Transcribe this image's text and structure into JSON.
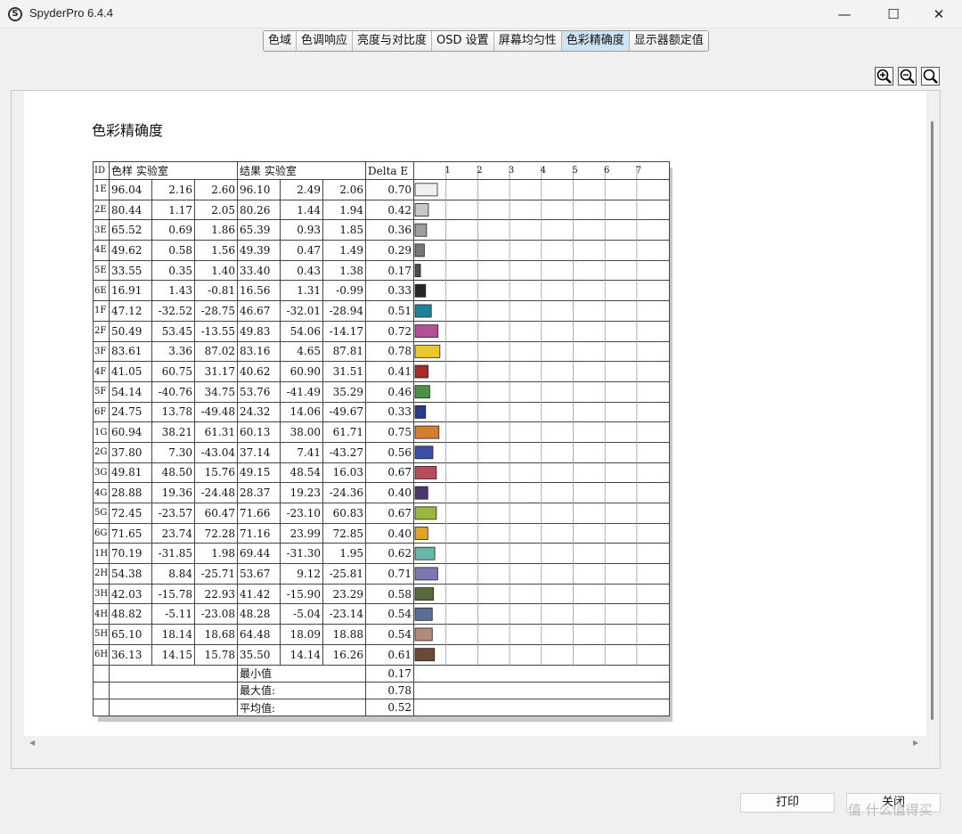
{
  "window": {
    "title": "SpyderPro 6.4.4",
    "app_icon": "S"
  },
  "tabs": [
    {
      "label": "色域",
      "active": false
    },
    {
      "label": "色调响应",
      "active": false
    },
    {
      "label": "亮度与对比度",
      "active": false
    },
    {
      "label": "OSD 设置",
      "active": false
    },
    {
      "label": "屏幕均匀性",
      "active": false
    },
    {
      "label": "色彩精确度",
      "active": true
    },
    {
      "label": "显示器额定值",
      "active": false
    }
  ],
  "zoom_icons": [
    "zoom-in-icon",
    "zoom-out-icon",
    "zoom-reset-icon"
  ],
  "report": {
    "title": "色彩精确度",
    "headers": {
      "id": "ID",
      "sample": "色样 实验室",
      "result": "结果 实验室",
      "delta": "Delta E"
    },
    "summary": [
      {
        "label": "最小值",
        "value": "0.17"
      },
      {
        "label": "最大值:",
        "value": "0.78"
      },
      {
        "label": "平均值:",
        "value": "0.52"
      }
    ]
  },
  "chart_data": {
    "type": "bar",
    "orientation": "horizontal",
    "x_ticks": [
      "1",
      "2",
      "3",
      "4",
      "5",
      "6",
      "7"
    ],
    "xlim": [
      0,
      7.8
    ],
    "grid": true,
    "rows": [
      {
        "id": "1E",
        "s": [
          "96.04",
          "2.16",
          "2.60"
        ],
        "r": [
          "96.10",
          "2.49",
          "2.06"
        ],
        "de": 0.7,
        "color": "#f2f0ed"
      },
      {
        "id": "2E",
        "s": [
          "80.44",
          "1.17",
          "2.05"
        ],
        "r": [
          "80.26",
          "1.44",
          "1.94"
        ],
        "de": 0.42,
        "color": "#c8c8c8"
      },
      {
        "id": "3E",
        "s": [
          "65.52",
          "0.69",
          "1.86"
        ],
        "r": [
          "65.39",
          "0.93",
          "1.85"
        ],
        "de": 0.36,
        "color": "#9e9e9e"
      },
      {
        "id": "4E",
        "s": [
          "49.62",
          "0.58",
          "1.56"
        ],
        "r": [
          "49.39",
          "0.47",
          "1.49"
        ],
        "de": 0.29,
        "color": "#777777"
      },
      {
        "id": "5E",
        "s": [
          "33.55",
          "0.35",
          "1.40"
        ],
        "r": [
          "33.40",
          "0.43",
          "1.38"
        ],
        "de": 0.17,
        "color": "#4e4e4e"
      },
      {
        "id": "6E",
        "s": [
          "16.91",
          "1.43",
          "-0.81"
        ],
        "r": [
          "16.56",
          "1.31",
          "-0.99"
        ],
        "de": 0.33,
        "color": "#262626"
      },
      {
        "id": "1F",
        "s": [
          "47.12",
          "-32.52",
          "-28.75"
        ],
        "r": [
          "46.67",
          "-32.01",
          "-28.94"
        ],
        "de": 0.51,
        "color": "#1f7f9f"
      },
      {
        "id": "2F",
        "s": [
          "50.49",
          "53.45",
          "-13.55"
        ],
        "r": [
          "49.83",
          "54.06",
          "-14.17"
        ],
        "de": 0.72,
        "color": "#b44e97"
      },
      {
        "id": "3F",
        "s": [
          "83.61",
          "3.36",
          "87.02"
        ],
        "r": [
          "83.16",
          "4.65",
          "87.81"
        ],
        "de": 0.78,
        "color": "#e8c82e"
      },
      {
        "id": "4F",
        "s": [
          "41.05",
          "60.75",
          "31.17"
        ],
        "r": [
          "40.62",
          "60.90",
          "31.51"
        ],
        "de": 0.41,
        "color": "#a82a2a"
      },
      {
        "id": "5F",
        "s": [
          "54.14",
          "-40.76",
          "34.75"
        ],
        "r": [
          "53.76",
          "-41.49",
          "35.29"
        ],
        "de": 0.46,
        "color": "#4a9044"
      },
      {
        "id": "6F",
        "s": [
          "24.75",
          "13.78",
          "-49.48"
        ],
        "r": [
          "24.32",
          "14.06",
          "-49.67"
        ],
        "de": 0.33,
        "color": "#283a8c"
      },
      {
        "id": "1G",
        "s": [
          "60.94",
          "38.21",
          "61.31"
        ],
        "r": [
          "60.13",
          "38.00",
          "61.71"
        ],
        "de": 0.75,
        "color": "#d27e2e"
      },
      {
        "id": "2G",
        "s": [
          "37.80",
          "7.30",
          "-43.04"
        ],
        "r": [
          "37.14",
          "7.41",
          "-43.27"
        ],
        "de": 0.56,
        "color": "#3c4fa0"
      },
      {
        "id": "3G",
        "s": [
          "49.81",
          "48.50",
          "15.76"
        ],
        "r": [
          "49.15",
          "48.54",
          "16.03"
        ],
        "de": 0.67,
        "color": "#b64c5c"
      },
      {
        "id": "4G",
        "s": [
          "28.88",
          "19.36",
          "-24.48"
        ],
        "r": [
          "28.37",
          "19.23",
          "-24.36"
        ],
        "de": 0.4,
        "color": "#4e366e"
      },
      {
        "id": "5G",
        "s": [
          "72.45",
          "-23.57",
          "60.47"
        ],
        "r": [
          "71.66",
          "-23.10",
          "60.83"
        ],
        "de": 0.67,
        "color": "#98b83c"
      },
      {
        "id": "6G",
        "s": [
          "71.65",
          "23.74",
          "72.28"
        ],
        "r": [
          "71.16",
          "23.99",
          "72.85"
        ],
        "de": 0.4,
        "color": "#e4a228"
      },
      {
        "id": "1H",
        "s": [
          "70.19",
          "-31.85",
          "1.98"
        ],
        "r": [
          "69.44",
          "-31.30",
          "1.95"
        ],
        "de": 0.62,
        "color": "#6ab6a6"
      },
      {
        "id": "2H",
        "s": [
          "54.38",
          "8.84",
          "-25.71"
        ],
        "r": [
          "53.67",
          "9.12",
          "-25.81"
        ],
        "de": 0.71,
        "color": "#7a78ae"
      },
      {
        "id": "3H",
        "s": [
          "42.03",
          "-15.78",
          "22.93"
        ],
        "r": [
          "41.42",
          "-15.90",
          "23.29"
        ],
        "de": 0.58,
        "color": "#5a6a3a"
      },
      {
        "id": "4H",
        "s": [
          "48.82",
          "-5.11",
          "-23.08"
        ],
        "r": [
          "48.28",
          "-5.04",
          "-23.14"
        ],
        "de": 0.54,
        "color": "#5a6c98"
      },
      {
        "id": "5H",
        "s": [
          "65.10",
          "18.14",
          "18.68"
        ],
        "r": [
          "64.48",
          "18.09",
          "18.88"
        ],
        "de": 0.54,
        "color": "#b08a7a"
      },
      {
        "id": "6H",
        "s": [
          "36.13",
          "14.15",
          "15.78"
        ],
        "r": [
          "35.50",
          "14.14",
          "16.26"
        ],
        "de": 0.61,
        "color": "#6a4a36"
      }
    ]
  },
  "buttons": {
    "print": "打印",
    "close": "关闭"
  },
  "watermark": "值 什么值得买"
}
